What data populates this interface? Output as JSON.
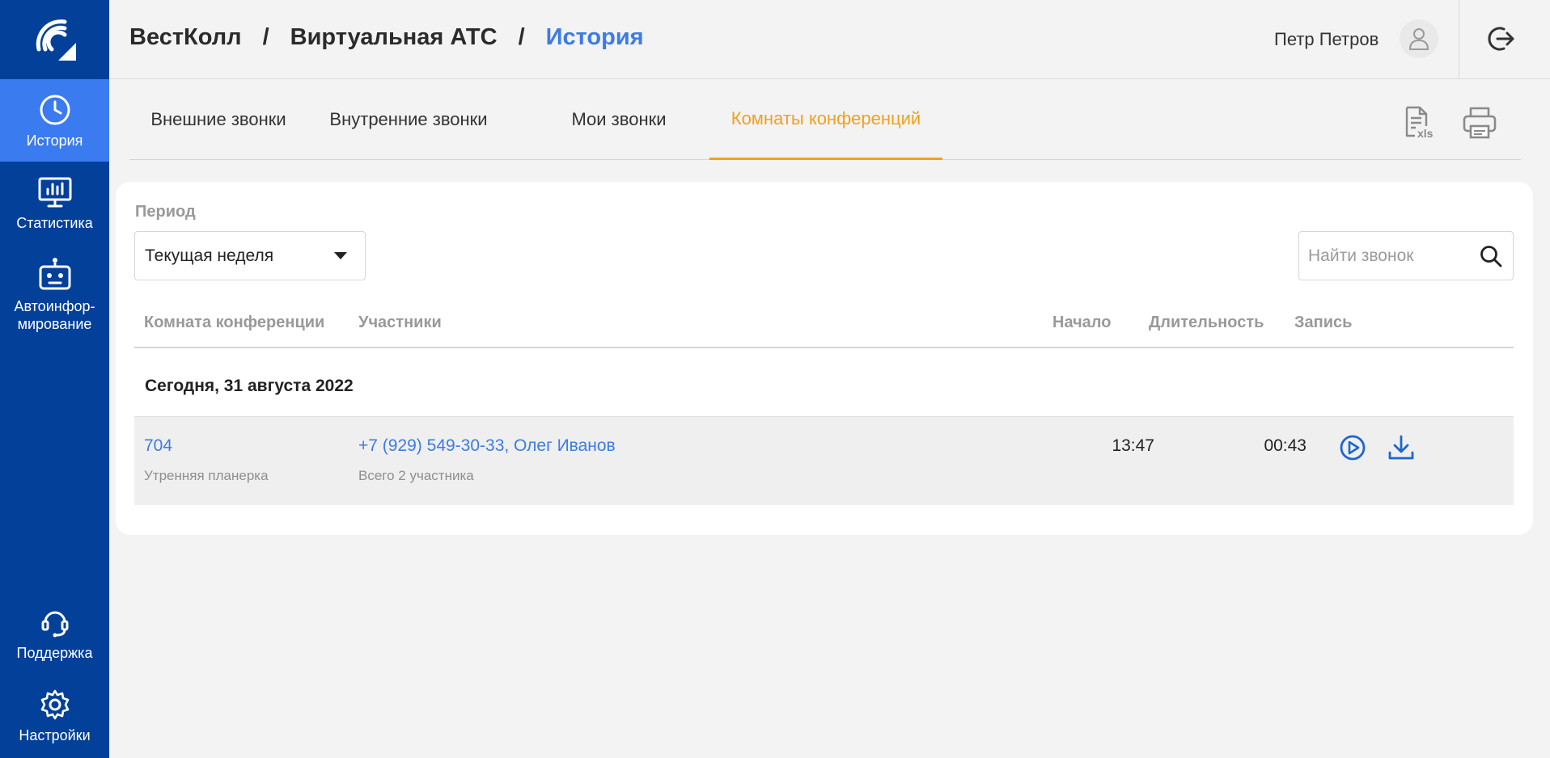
{
  "app": {
    "breadcrumb": [
      "ВестКолл",
      "Виртуальная АТС",
      "История"
    ],
    "separator": "/"
  },
  "user": {
    "name": "Петр Петров"
  },
  "sidebar": {
    "items": [
      {
        "label": "История",
        "icon": "clock-icon",
        "active": true
      },
      {
        "label": "Статистика",
        "icon": "monitor-chart-icon"
      },
      {
        "label": "Автоинфор-мирование",
        "line1": "Автоинфор-",
        "line2": "мирование",
        "icon": "robot-icon"
      },
      {
        "label": "Поддержка",
        "icon": "headset-icon"
      },
      {
        "label": "Настройки",
        "icon": "gear-icon"
      }
    ]
  },
  "tabs": [
    {
      "label": "Внешние звонки"
    },
    {
      "label": "Внутренние звонки"
    },
    {
      "label": "Мои звонки"
    },
    {
      "label": "Комнаты конференций",
      "active": true
    }
  ],
  "toolbar": {
    "export_icon": "xls-file-icon",
    "print_icon": "printer-icon"
  },
  "filter": {
    "period_label": "Период",
    "period_value": "Текущая неделя",
    "search_placeholder": "Найти звонок"
  },
  "table": {
    "columns": [
      "Комната конференции",
      "Участники",
      "Начало",
      "Длительность",
      "Запись"
    ],
    "groups": [
      {
        "date": "Сегодня, 31 августа 2022",
        "rows": [
          {
            "room": "704",
            "room_desc": "Утренняя планерка",
            "participants": "+7 (929) 549-30-33, Олег Иванов",
            "participants_count": "Всего 2 участника",
            "start": "13:47",
            "duration": "00:43"
          }
        ]
      }
    ]
  },
  "colors": {
    "sidebar": "#02409a",
    "sidebar_active": "#3a7bf0",
    "accent_tab": "#f2a01e",
    "link": "#3d7be6"
  }
}
